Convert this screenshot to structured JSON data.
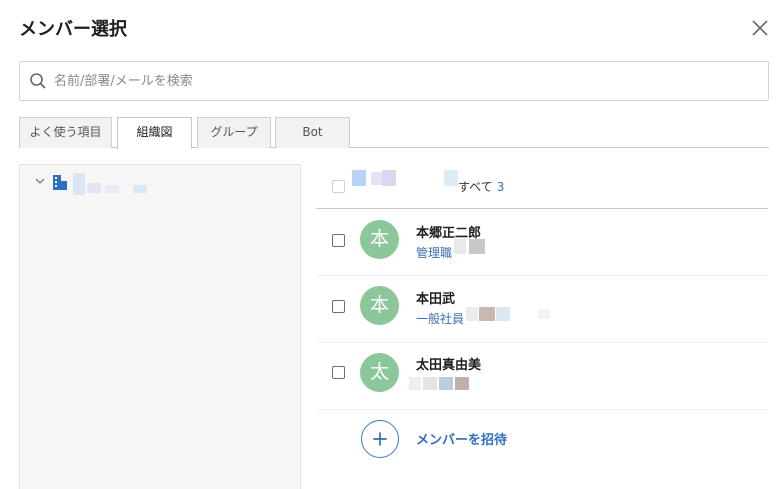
{
  "dialog": {
    "title": "メンバー選択",
    "close_icon": "close-icon"
  },
  "search": {
    "placeholder": "名前/部署/メールを検索",
    "value": ""
  },
  "tabs": [
    {
      "label": "よく使う項目",
      "active": false
    },
    {
      "label": "組織図",
      "active": true
    },
    {
      "label": "グループ",
      "active": false
    },
    {
      "label": "Bot",
      "active": false
    }
  ],
  "tree": {
    "expand_icon": "chevron-down-icon",
    "org_icon": "building-icon"
  },
  "list": {
    "select_all_label": "すべて",
    "select_all_count": "3",
    "members": [
      {
        "avatar_char": "本",
        "name": "本郷正二郎",
        "role": "管理職"
      },
      {
        "avatar_char": "本",
        "name": "本田武",
        "role": "一般社員"
      },
      {
        "avatar_char": "太",
        "name": "太田真由美",
        "role": ""
      }
    ],
    "invite_label": "メンバーを招待"
  },
  "colors": {
    "accent": "#2f6fc0",
    "avatar": "#8cc79c",
    "panel": "#f6f6f6"
  }
}
